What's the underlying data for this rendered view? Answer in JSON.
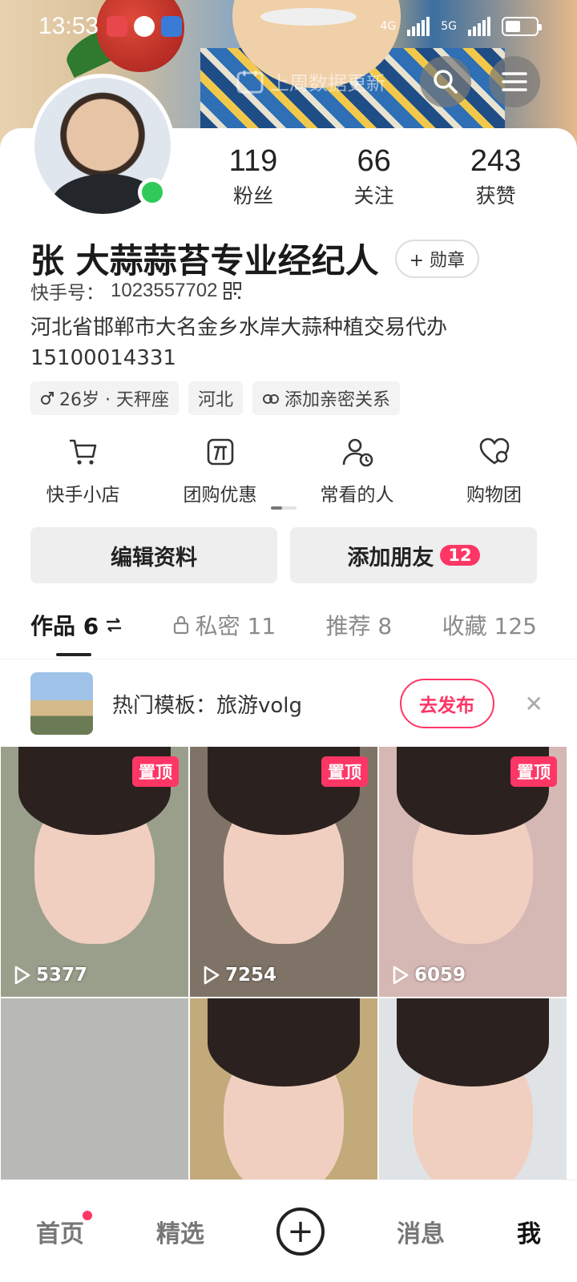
{
  "status_bar": {
    "time": "13:53",
    "network_1": "4G",
    "network_2": "5G"
  },
  "header": {
    "data_updated_text": "上周数据更新"
  },
  "profile": {
    "name": "张 大蒜蒜苔专业经纪人",
    "medal_button": "+ 勋章",
    "kuaishou_id_label": "快手号：",
    "kuaishou_id": "1023557702",
    "bio": "河北省邯郸市大名金乡水岸大蒜种植交易代办\n15100014331",
    "stats": [
      {
        "value": "119",
        "label": "粉丝"
      },
      {
        "value": "66",
        "label": "关注"
      },
      {
        "value": "243",
        "label": "获赞"
      }
    ],
    "tags": [
      "26岁 · 天秤座",
      "河北",
      "添加亲密关系"
    ]
  },
  "shortcuts": [
    {
      "label": "快手小店",
      "icon": "cart-icon"
    },
    {
      "label": "团购优惠",
      "icon": "group-buy-icon"
    },
    {
      "label": "常看的人",
      "icon": "frequent-people-icon"
    },
    {
      "label": "购物团",
      "icon": "shopping-group-icon"
    }
  ],
  "actions": {
    "edit": "编辑资料",
    "add_friend": "添加朋友",
    "add_friend_badge": "12"
  },
  "tabs": [
    {
      "label": "作品 6",
      "active": true
    },
    {
      "label": "私密 11",
      "active": false
    },
    {
      "label": "推荐 8",
      "active": false
    },
    {
      "label": "收藏 125",
      "active": false
    }
  ],
  "template_banner": {
    "text": "热门模板：旅游volg",
    "button": "去发布"
  },
  "videos": [
    {
      "pinned": "置顶",
      "views": "5377",
      "bg": "#9a9f8c"
    },
    {
      "pinned": "置顶",
      "views": "7254",
      "bg": "#7e7366"
    },
    {
      "pinned": "置顶",
      "views": "6059",
      "bg": "#d5b7b4"
    },
    {
      "pinned": "",
      "views": "",
      "bg": "#b8b8b6"
    },
    {
      "pinned": "",
      "views": "",
      "bg": "#c2aa7a"
    },
    {
      "pinned": "",
      "views": "",
      "bg": "#dfe3e6"
    }
  ],
  "bottom_nav": [
    "首页",
    "精选",
    "消息",
    "我"
  ],
  "colors": {
    "accent": "#fe3666",
    "online": "#2fca5a"
  }
}
